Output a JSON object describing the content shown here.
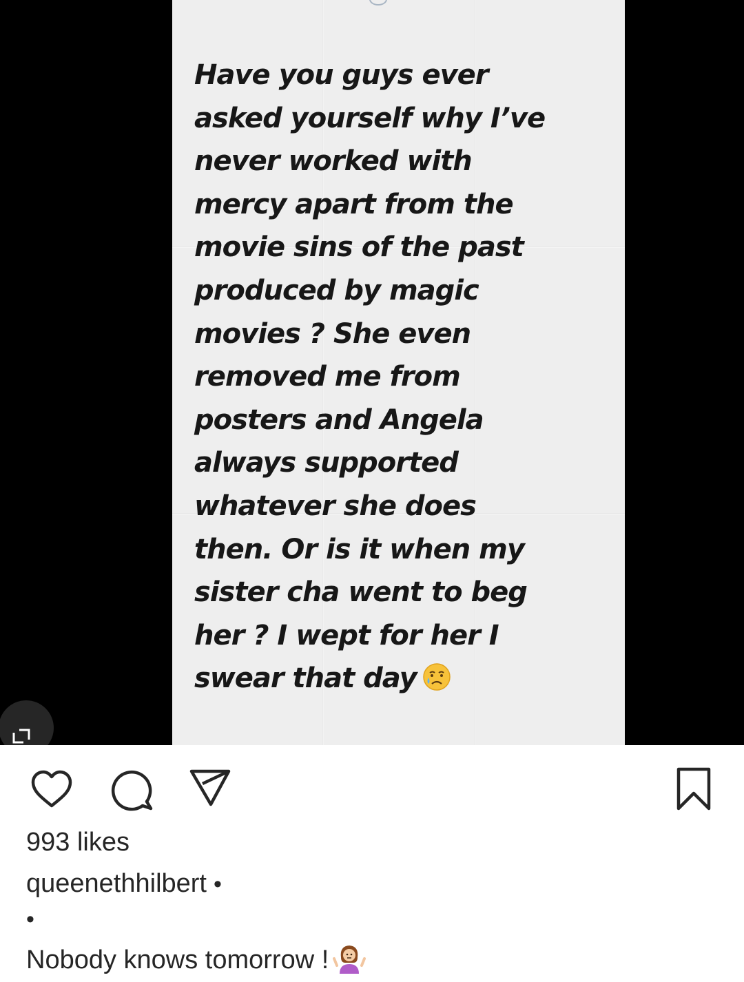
{
  "post": {
    "story_lines": [
      "Have you guys ever",
      "asked yourself why I’ve",
      "never worked with",
      "mercy apart from the",
      "movie sins of the past",
      "produced by magic",
      "movies ? She even",
      "removed me from",
      "posters and Angela",
      "always supported",
      "whatever she does",
      "then. Or is it when my",
      "sister cha went to beg",
      "her ? I wept for her I",
      "swear that day"
    ],
    "story_emoji": "crying-face-icon"
  },
  "actions": {
    "like_icon": "heart-icon",
    "comment_icon": "comment-icon",
    "share_icon": "send-icon",
    "save_icon": "bookmark-icon",
    "expand_icon": "expand-icon"
  },
  "likes": {
    "text": "993 likes"
  },
  "caption": {
    "username": "queenethhilbert",
    "separator": "•",
    "bullet_line": "•",
    "text": "Nobody knows tomorrow !",
    "emoji": "person-shrugging-icon"
  },
  "colors": {
    "media_background": "#000000",
    "story_background": "#eeeeee",
    "story_text": "#171717",
    "ui_text": "#262626",
    "page_background": "#ffffff"
  }
}
